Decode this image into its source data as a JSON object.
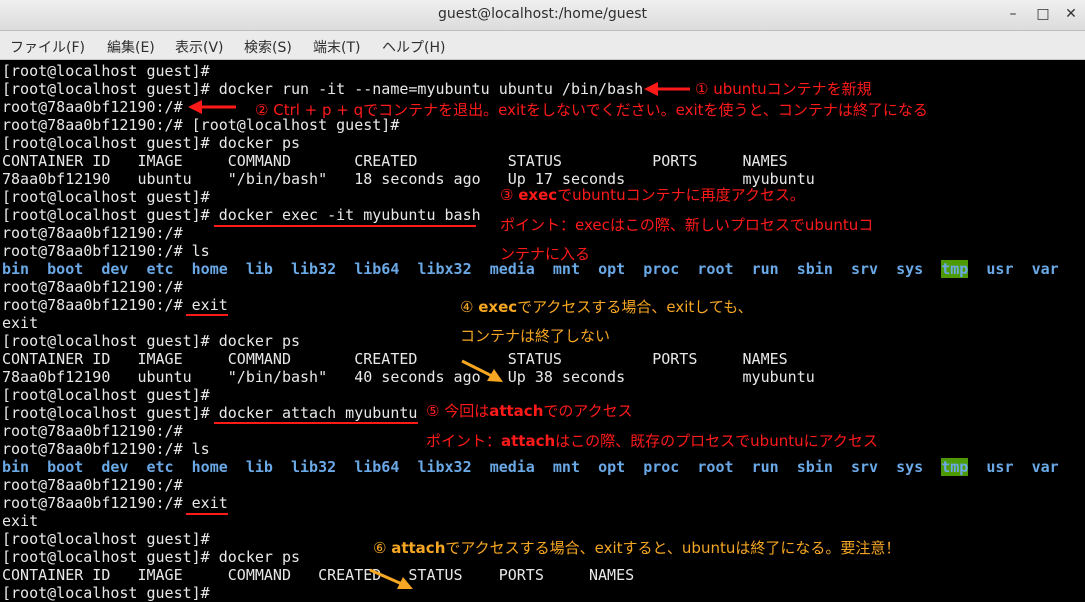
{
  "window": {
    "title": "guest@localhost:/home/guest",
    "min_label": "–",
    "max_label": "□",
    "close_label": "✕"
  },
  "menu": [
    "ファイル(F)",
    "編集(E)",
    "表示(V)",
    "検索(S)",
    "端末(T)",
    "ヘルプ(H)"
  ],
  "terminal": {
    "l1": "[root@localhost guest]#",
    "l2": "[root@localhost guest]# docker run -it --name=myubuntu ubuntu /bin/bash",
    "l3": "root@78aa0bf12190:/#",
    "l4": "root@78aa0bf12190:/# [root@localhost guest]#",
    "l5": "[root@localhost guest]# docker ps",
    "l6": "CONTAINER ID   IMAGE     COMMAND       CREATED          STATUS          PORTS     NAMES",
    "l7": "78aa0bf12190   ubuntu    \"/bin/bash\"   18 seconds ago   Up 17 seconds             myubuntu",
    "l8": "[root@localhost guest]#",
    "l9": "[root@localhost guest]# docker exec -it myubuntu bash",
    "l10": "root@78aa0bf12190:/#",
    "l11": "root@78aa0bf12190:/# ls",
    "ls_dirs": [
      "bin",
      "boot",
      "dev",
      "etc",
      "home",
      "lib",
      "lib32",
      "lib64",
      "libx32",
      "media",
      "mnt",
      "opt",
      "proc",
      "root",
      "run",
      "sbin",
      "srv",
      "sys",
      "tmp",
      "usr",
      "var"
    ],
    "l13": "root@78aa0bf12190:/#",
    "l14": "root@78aa0bf12190:/# exit",
    "l15": "exit",
    "l16": "[root@localhost guest]# docker ps",
    "l17": "CONTAINER ID   IMAGE     COMMAND       CREATED          STATUS          PORTS     NAMES",
    "l18": "78aa0bf12190   ubuntu    \"/bin/bash\"   40 seconds ago   Up 38 seconds             myubuntu",
    "l19": "[root@localhost guest]#",
    "l20": "[root@localhost guest]# docker attach myubuntu",
    "l21": "root@78aa0bf12190:/#",
    "l22": "root@78aa0bf12190:/# ls",
    "l24": "root@78aa0bf12190:/#",
    "l25": "root@78aa0bf12190:/# exit",
    "l26": "exit",
    "l27": "[root@localhost guest]#",
    "l28": "[root@localhost guest]# docker ps",
    "l29": "CONTAINER ID   IMAGE     COMMAND   CREATED   STATUS    PORTS     NAMES",
    "l30": "[root@localhost guest]#"
  },
  "annotations": {
    "a1": "① ubuntuコンテナを新規",
    "a2": "② Ctrl + p + qでコンテナを退出。exitをしないでください。exitを使うと、コンテナは終了になる",
    "a3_pre": "③ ",
    "a3_bold": "exec",
    "a3_post": "でubuntuコンテナに再度アクセス。",
    "a3b": "ポイント：execはこの際、新しいプロセスでubuntuコ",
    "a3c": "ンテナに入る",
    "a4_pre": "④ ",
    "a4_bold": "exec",
    "a4_post": "でアクセスする場合、exitしても、",
    "a4b": "コンテナは終了しない",
    "a5_pre": "⑤ 今回は",
    "a5_bold": "attach",
    "a5_post": "でのアクセス",
    "a5b_pre": "ポイント：",
    "a5b_bold": "attach",
    "a5b_post": "はこの際、既存のプロセスでubuntuにアクセス",
    "a6_pre": "⑥ ",
    "a6_bold": "attach",
    "a6_post": "でアクセスする場合、exitすると、ubuntuは終了になる。要注意！"
  },
  "colors": {
    "red": "#ff1a1a",
    "orange": "#f5a623",
    "dir_blue": "#6aa8e6",
    "tmp_bg": "#4e9a06"
  }
}
